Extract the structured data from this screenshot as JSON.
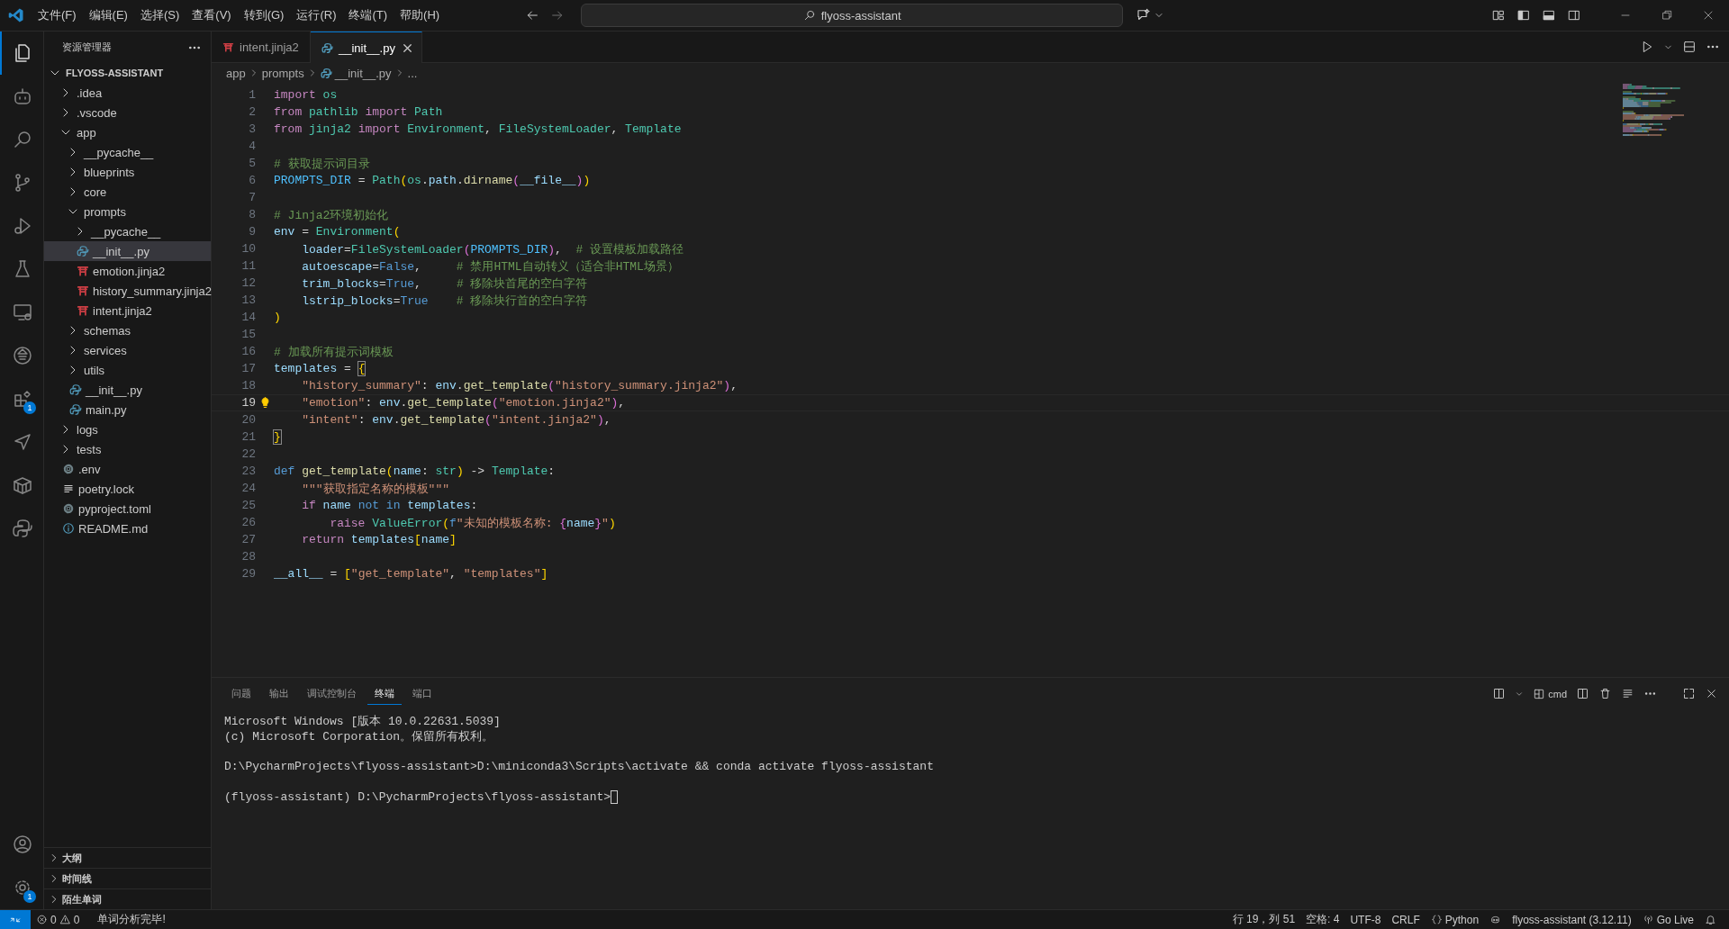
{
  "title_bar": {
    "menu": [
      "文件(F)",
      "编辑(E)",
      "选择(S)",
      "查看(V)",
      "转到(G)",
      "运行(R)",
      "终端(T)",
      "帮助(H)"
    ],
    "command_center": {
      "label": "flyoss-assistant"
    }
  },
  "activity_bar": {
    "items": [
      {
        "kind": "files",
        "selected": true
      },
      {
        "kind": "robot",
        "selected": false
      },
      {
        "kind": "search",
        "selected": false
      },
      {
        "kind": "branch",
        "selected": false
      },
      {
        "kind": "debug",
        "selected": false
      },
      {
        "kind": "flask",
        "selected": false
      },
      {
        "kind": "monitor",
        "selected": false
      },
      {
        "kind": "emblem",
        "selected": false
      },
      {
        "kind": "extensions",
        "selected": false,
        "badge": "1"
      },
      {
        "kind": "send",
        "selected": false
      },
      {
        "kind": "box",
        "selected": false
      },
      {
        "kind": "python",
        "selected": false
      }
    ],
    "bottom": [
      {
        "kind": "account",
        "selected": false
      },
      {
        "kind": "gear",
        "selected": false,
        "badge": "1"
      }
    ]
  },
  "explorer": {
    "title": "资源管理器",
    "root": {
      "name": "FLYOSS-ASSISTANT",
      "expanded": true,
      "children": [
        {
          "name": ".idea",
          "kind": "folder",
          "expanded": false,
          "selected": false
        },
        {
          "name": ".vscode",
          "kind": "folder",
          "expanded": false,
          "selected": false
        },
        {
          "name": "app",
          "kind": "folder",
          "expanded": true,
          "selected": false,
          "children": [
            {
              "name": "__pycache__",
              "kind": "folder",
              "expanded": false,
              "selected": false
            },
            {
              "name": "blueprints",
              "kind": "folder",
              "expanded": false,
              "selected": false
            },
            {
              "name": "core",
              "kind": "folder",
              "expanded": false,
              "selected": false
            },
            {
              "name": "prompts",
              "kind": "folder",
              "expanded": true,
              "selected": false,
              "children": [
                {
                  "name": "__pycache__",
                  "kind": "folder",
                  "expanded": false,
                  "selected": false
                },
                {
                  "name": "__init__.py",
                  "kind": "python",
                  "selected": true
                },
                {
                  "name": "emotion.jinja2",
                  "kind": "jinja",
                  "selected": false
                },
                {
                  "name": "history_summary.jinja2",
                  "kind": "jinja",
                  "selected": false
                },
                {
                  "name": "intent.jinja2",
                  "kind": "jinja",
                  "selected": false
                }
              ]
            },
            {
              "name": "schemas",
              "kind": "folder",
              "expanded": false,
              "selected": false
            },
            {
              "name": "services",
              "kind": "folder",
              "expanded": false,
              "selected": false
            },
            {
              "name": "utils",
              "kind": "folder",
              "expanded": false,
              "selected": false
            },
            {
              "name": "__init__.py",
              "kind": "python",
              "selected": false
            },
            {
              "name": "main.py",
              "kind": "python",
              "selected": false
            }
          ]
        },
        {
          "name": "logs",
          "kind": "folder",
          "expanded": false,
          "selected": false
        },
        {
          "name": "tests",
          "kind": "folder",
          "expanded": false,
          "selected": false
        },
        {
          "name": ".env",
          "kind": "settings",
          "selected": false
        },
        {
          "name": "poetry.lock",
          "kind": "lines",
          "selected": false
        },
        {
          "name": "pyproject.toml",
          "kind": "settings",
          "selected": false
        },
        {
          "name": "README.md",
          "kind": "info",
          "selected": false
        }
      ]
    },
    "sections": [
      {
        "title": "大纲",
        "expanded": false
      },
      {
        "title": "时间线",
        "expanded": false
      },
      {
        "title": "陌生单词",
        "expanded": false
      }
    ]
  },
  "editor": {
    "tabs": [
      {
        "label": "intent.jinja2",
        "kind": "jinja",
        "selected": false
      },
      {
        "label": "__init__.py",
        "kind": "python",
        "selected": true
      }
    ],
    "breadcrumb": [
      {
        "text": "app"
      },
      {
        "text": "prompts"
      },
      {
        "text": "__init__.py",
        "kind": "python"
      },
      {
        "text": "..."
      }
    ],
    "lines": [
      {
        "number": "1",
        "current": false,
        "tokens": [
          {
            "kind": "kw",
            "text": "import "
          },
          {
            "kind": "mod",
            "text": "os"
          }
        ]
      },
      {
        "number": "2",
        "current": false,
        "tokens": [
          {
            "kind": "kw",
            "text": "from "
          },
          {
            "kind": "mod",
            "text": "pathlib "
          },
          {
            "kind": "kw",
            "text": "import "
          },
          {
            "kind": "cls",
            "text": "Path"
          }
        ]
      },
      {
        "number": "3",
        "current": false,
        "tokens": [
          {
            "kind": "kw",
            "text": "from "
          },
          {
            "kind": "mod",
            "text": "jinja2 "
          },
          {
            "kind": "kw",
            "text": "import "
          },
          {
            "kind": "cls",
            "text": "Environment"
          },
          {
            "kind": "p",
            "text": ", "
          },
          {
            "kind": "cls",
            "text": "FileSystemLoader"
          },
          {
            "kind": "p",
            "text": ", "
          },
          {
            "kind": "cls",
            "text": "Template"
          }
        ]
      },
      {
        "number": "4",
        "current": false
      },
      {
        "number": "5",
        "current": false,
        "tokens": [
          {
            "kind": "com",
            "text": "# 获取提示词目录"
          }
        ]
      },
      {
        "number": "6",
        "current": false,
        "tokens": [
          {
            "kind": "const",
            "text": "PROMPTS_DIR"
          },
          {
            "kind": "p",
            "text": " = "
          },
          {
            "kind": "cls",
            "text": "Path"
          },
          {
            "kind": "b1",
            "text": "("
          },
          {
            "kind": "mod",
            "text": "os"
          },
          {
            "kind": "p",
            "text": "."
          },
          {
            "kind": "var",
            "text": "path"
          },
          {
            "kind": "p",
            "text": "."
          },
          {
            "kind": "fn",
            "text": "dirname"
          },
          {
            "kind": "b2",
            "text": "("
          },
          {
            "kind": "var",
            "text": "__file__"
          },
          {
            "kind": "b2",
            "text": ")"
          },
          {
            "kind": "b1",
            "text": ")"
          }
        ]
      },
      {
        "number": "7",
        "current": false
      },
      {
        "number": "8",
        "current": false,
        "tokens": [
          {
            "kind": "com",
            "text": "# Jinja2环境初始化"
          }
        ]
      },
      {
        "number": "9",
        "current": false,
        "tokens": [
          {
            "kind": "var",
            "text": "env"
          },
          {
            "kind": "p",
            "text": " = "
          },
          {
            "kind": "cls",
            "text": "Environment"
          },
          {
            "kind": "b1",
            "text": "("
          }
        ]
      },
      {
        "number": "10",
        "current": false,
        "tokens": [
          {
            "kind": "var",
            "text": "    loader"
          },
          {
            "kind": "p",
            "text": "="
          },
          {
            "kind": "cls",
            "text": "FileSystemLoader"
          },
          {
            "kind": "b2",
            "text": "("
          },
          {
            "kind": "const",
            "text": "PROMPTS_DIR"
          },
          {
            "kind": "b2",
            "text": ")"
          },
          {
            "kind": "p",
            "text": ",  "
          },
          {
            "kind": "com",
            "text": "# 设置模板加载路径"
          }
        ]
      },
      {
        "number": "11",
        "current": false,
        "tokens": [
          {
            "kind": "var",
            "text": "    autoescape"
          },
          {
            "kind": "p",
            "text": "="
          },
          {
            "kind": "kwb",
            "text": "False"
          },
          {
            "kind": "p",
            "text": ",     "
          },
          {
            "kind": "com",
            "text": "# 禁用HTML自动转义（适合非HTML场景）"
          }
        ]
      },
      {
        "number": "12",
        "current": false,
        "tokens": [
          {
            "kind": "var",
            "text": "    trim_blocks"
          },
          {
            "kind": "p",
            "text": "="
          },
          {
            "kind": "kwb",
            "text": "True"
          },
          {
            "kind": "p",
            "text": ",     "
          },
          {
            "kind": "com",
            "text": "# 移除块首尾的空白字符"
          }
        ]
      },
      {
        "number": "13",
        "current": false,
        "tokens": [
          {
            "kind": "var",
            "text": "    lstrip_blocks"
          },
          {
            "kind": "p",
            "text": "="
          },
          {
            "kind": "kwb",
            "text": "True    "
          },
          {
            "kind": "com",
            "text": "# 移除块行首的空白字符"
          }
        ]
      },
      {
        "number": "14",
        "current": false,
        "tokens": [
          {
            "kind": "b1",
            "text": ")"
          }
        ]
      },
      {
        "number": "15",
        "current": false
      },
      {
        "number": "16",
        "current": false,
        "tokens": [
          {
            "kind": "com",
            "text": "# 加载所有提示词模板"
          }
        ]
      },
      {
        "number": "17",
        "current": false,
        "tokens": [
          {
            "kind": "var",
            "text": "templates"
          },
          {
            "kind": "p",
            "text": " = "
          },
          {
            "kind": "bm",
            "text": "{"
          }
        ]
      },
      {
        "number": "18",
        "current": false,
        "tokens": [
          {
            "kind": "str",
            "text": "    \"history_summary\""
          },
          {
            "kind": "p",
            "text": ": "
          },
          {
            "kind": "var",
            "text": "env"
          },
          {
            "kind": "p",
            "text": "."
          },
          {
            "kind": "fn",
            "text": "get_template"
          },
          {
            "kind": "b2",
            "text": "("
          },
          {
            "kind": "str",
            "text": "\"history_summary.jinja2\""
          },
          {
            "kind": "b2",
            "text": ")"
          },
          {
            "kind": "p",
            "text": ","
          }
        ]
      },
      {
        "number": "19",
        "current": true,
        "tokens": [
          {
            "kind": "str",
            "text": "    \"emotion\""
          },
          {
            "kind": "p",
            "text": ": "
          },
          {
            "kind": "var",
            "text": "env"
          },
          {
            "kind": "p",
            "text": "."
          },
          {
            "kind": "fn",
            "text": "get_template"
          },
          {
            "kind": "b2",
            "text": "("
          },
          {
            "kind": "str",
            "text": "\"emotion.jinja2\""
          },
          {
            "kind": "b2",
            "text": ")"
          },
          {
            "kind": "p",
            "text": ","
          }
        ]
      },
      {
        "number": "20",
        "current": false,
        "tokens": [
          {
            "kind": "str",
            "text": "    \"intent\""
          },
          {
            "kind": "p",
            "text": ": "
          },
          {
            "kind": "var",
            "text": "env"
          },
          {
            "kind": "p",
            "text": "."
          },
          {
            "kind": "fn",
            "text": "get_template"
          },
          {
            "kind": "b2",
            "text": "("
          },
          {
            "kind": "str",
            "text": "\"intent.jinja2\""
          },
          {
            "kind": "b2",
            "text": ")"
          },
          {
            "kind": "p",
            "text": ","
          }
        ]
      },
      {
        "number": "21",
        "current": false,
        "tokens": [
          {
            "kind": "bm",
            "text": "}"
          }
        ]
      },
      {
        "number": "22",
        "current": false
      },
      {
        "number": "23",
        "current": false,
        "tokens": [
          {
            "kind": "kwb",
            "text": "def "
          },
          {
            "kind": "fn",
            "text": "get_template"
          },
          {
            "kind": "b1",
            "text": "("
          },
          {
            "kind": "var",
            "text": "name"
          },
          {
            "kind": "p",
            "text": ": "
          },
          {
            "kind": "cls",
            "text": "str"
          },
          {
            "kind": "b1",
            "text": ")"
          },
          {
            "kind": "p",
            "text": " -> "
          },
          {
            "kind": "cls",
            "text": "Template"
          },
          {
            "kind": "p",
            "text": ":"
          }
        ]
      },
      {
        "number": "24",
        "current": false,
        "tokens": [
          {
            "kind": "str",
            "text": "    \"\"\"获取指定名称的模板\"\"\""
          }
        ]
      },
      {
        "number": "25",
        "current": false,
        "tokens": [
          {
            "kind": "kw",
            "text": "    if "
          },
          {
            "kind": "var",
            "text": "name "
          },
          {
            "kind": "kwb",
            "text": "not "
          },
          {
            "kind": "kwb",
            "text": "in "
          },
          {
            "kind": "var",
            "text": "templates"
          },
          {
            "kind": "p",
            "text": ":"
          }
        ]
      },
      {
        "number": "26",
        "current": false,
        "tokens": [
          {
            "kind": "kw",
            "text": "        raise "
          },
          {
            "kind": "cls",
            "text": "ValueError"
          },
          {
            "kind": "b1",
            "text": "("
          },
          {
            "kind": "kwb",
            "text": "f"
          },
          {
            "kind": "str",
            "text": "\"未知的模板名称: "
          },
          {
            "kind": "b2",
            "text": "{"
          },
          {
            "kind": "var",
            "text": "name"
          },
          {
            "kind": "b2",
            "text": "}"
          },
          {
            "kind": "str",
            "text": "\""
          },
          {
            "kind": "b1",
            "text": ")"
          }
        ]
      },
      {
        "number": "27",
        "current": false,
        "tokens": [
          {
            "kind": "kw",
            "text": "    return "
          },
          {
            "kind": "var",
            "text": "templates"
          },
          {
            "kind": "b1",
            "text": "["
          },
          {
            "kind": "var",
            "text": "name"
          },
          {
            "kind": "b1",
            "text": "]"
          }
        ]
      },
      {
        "number": "28",
        "current": false
      },
      {
        "number": "29",
        "current": false,
        "tokens": [
          {
            "kind": "var",
            "text": "__all__"
          },
          {
            "kind": "p",
            "text": " = "
          },
          {
            "kind": "b1",
            "text": "["
          },
          {
            "kind": "str",
            "text": "\"get_template\""
          },
          {
            "kind": "p",
            "text": ", "
          },
          {
            "kind": "str",
            "text": "\"templates\""
          },
          {
            "kind": "b1",
            "text": "]"
          }
        ]
      }
    ]
  },
  "panel": {
    "tabs": [
      {
        "label": "问题",
        "selected": false
      },
      {
        "label": "输出",
        "selected": false
      },
      {
        "label": "调试控制台",
        "selected": false
      },
      {
        "label": "终端",
        "selected": true
      },
      {
        "label": "端口",
        "selected": false
      }
    ],
    "shell": "cmd",
    "terminal": {
      "cursor": true,
      "blocks": [
        [
          "Microsoft Windows [版本 10.0.22631.5039]",
          "(c) Microsoft Corporation。保留所有权利。"
        ],
        [
          "D:\\PycharmProjects\\flyoss-assistant>D:\\miniconda3\\Scripts\\activate && conda activate flyoss-assistant"
        ],
        [
          "(flyoss-assistant) D:\\PycharmProjects\\flyoss-assistant>"
        ]
      ]
    }
  },
  "status_bar": {
    "errors": "0",
    "warnings": "0",
    "message": "单词分析完毕!",
    "right": [
      {
        "text": "行 19，列 51"
      },
      {
        "text": "空格: 4"
      },
      {
        "text": "UTF-8"
      },
      {
        "text": "CRLF"
      },
      {
        "text": "Python",
        "kind": "braces"
      },
      {
        "kind": "copilot"
      },
      {
        "text": "flyoss-assistant (3.12.11)"
      },
      {
        "text": "Go Live",
        "kind": "broadcast"
      },
      {
        "kind": "bell"
      }
    ]
  }
}
